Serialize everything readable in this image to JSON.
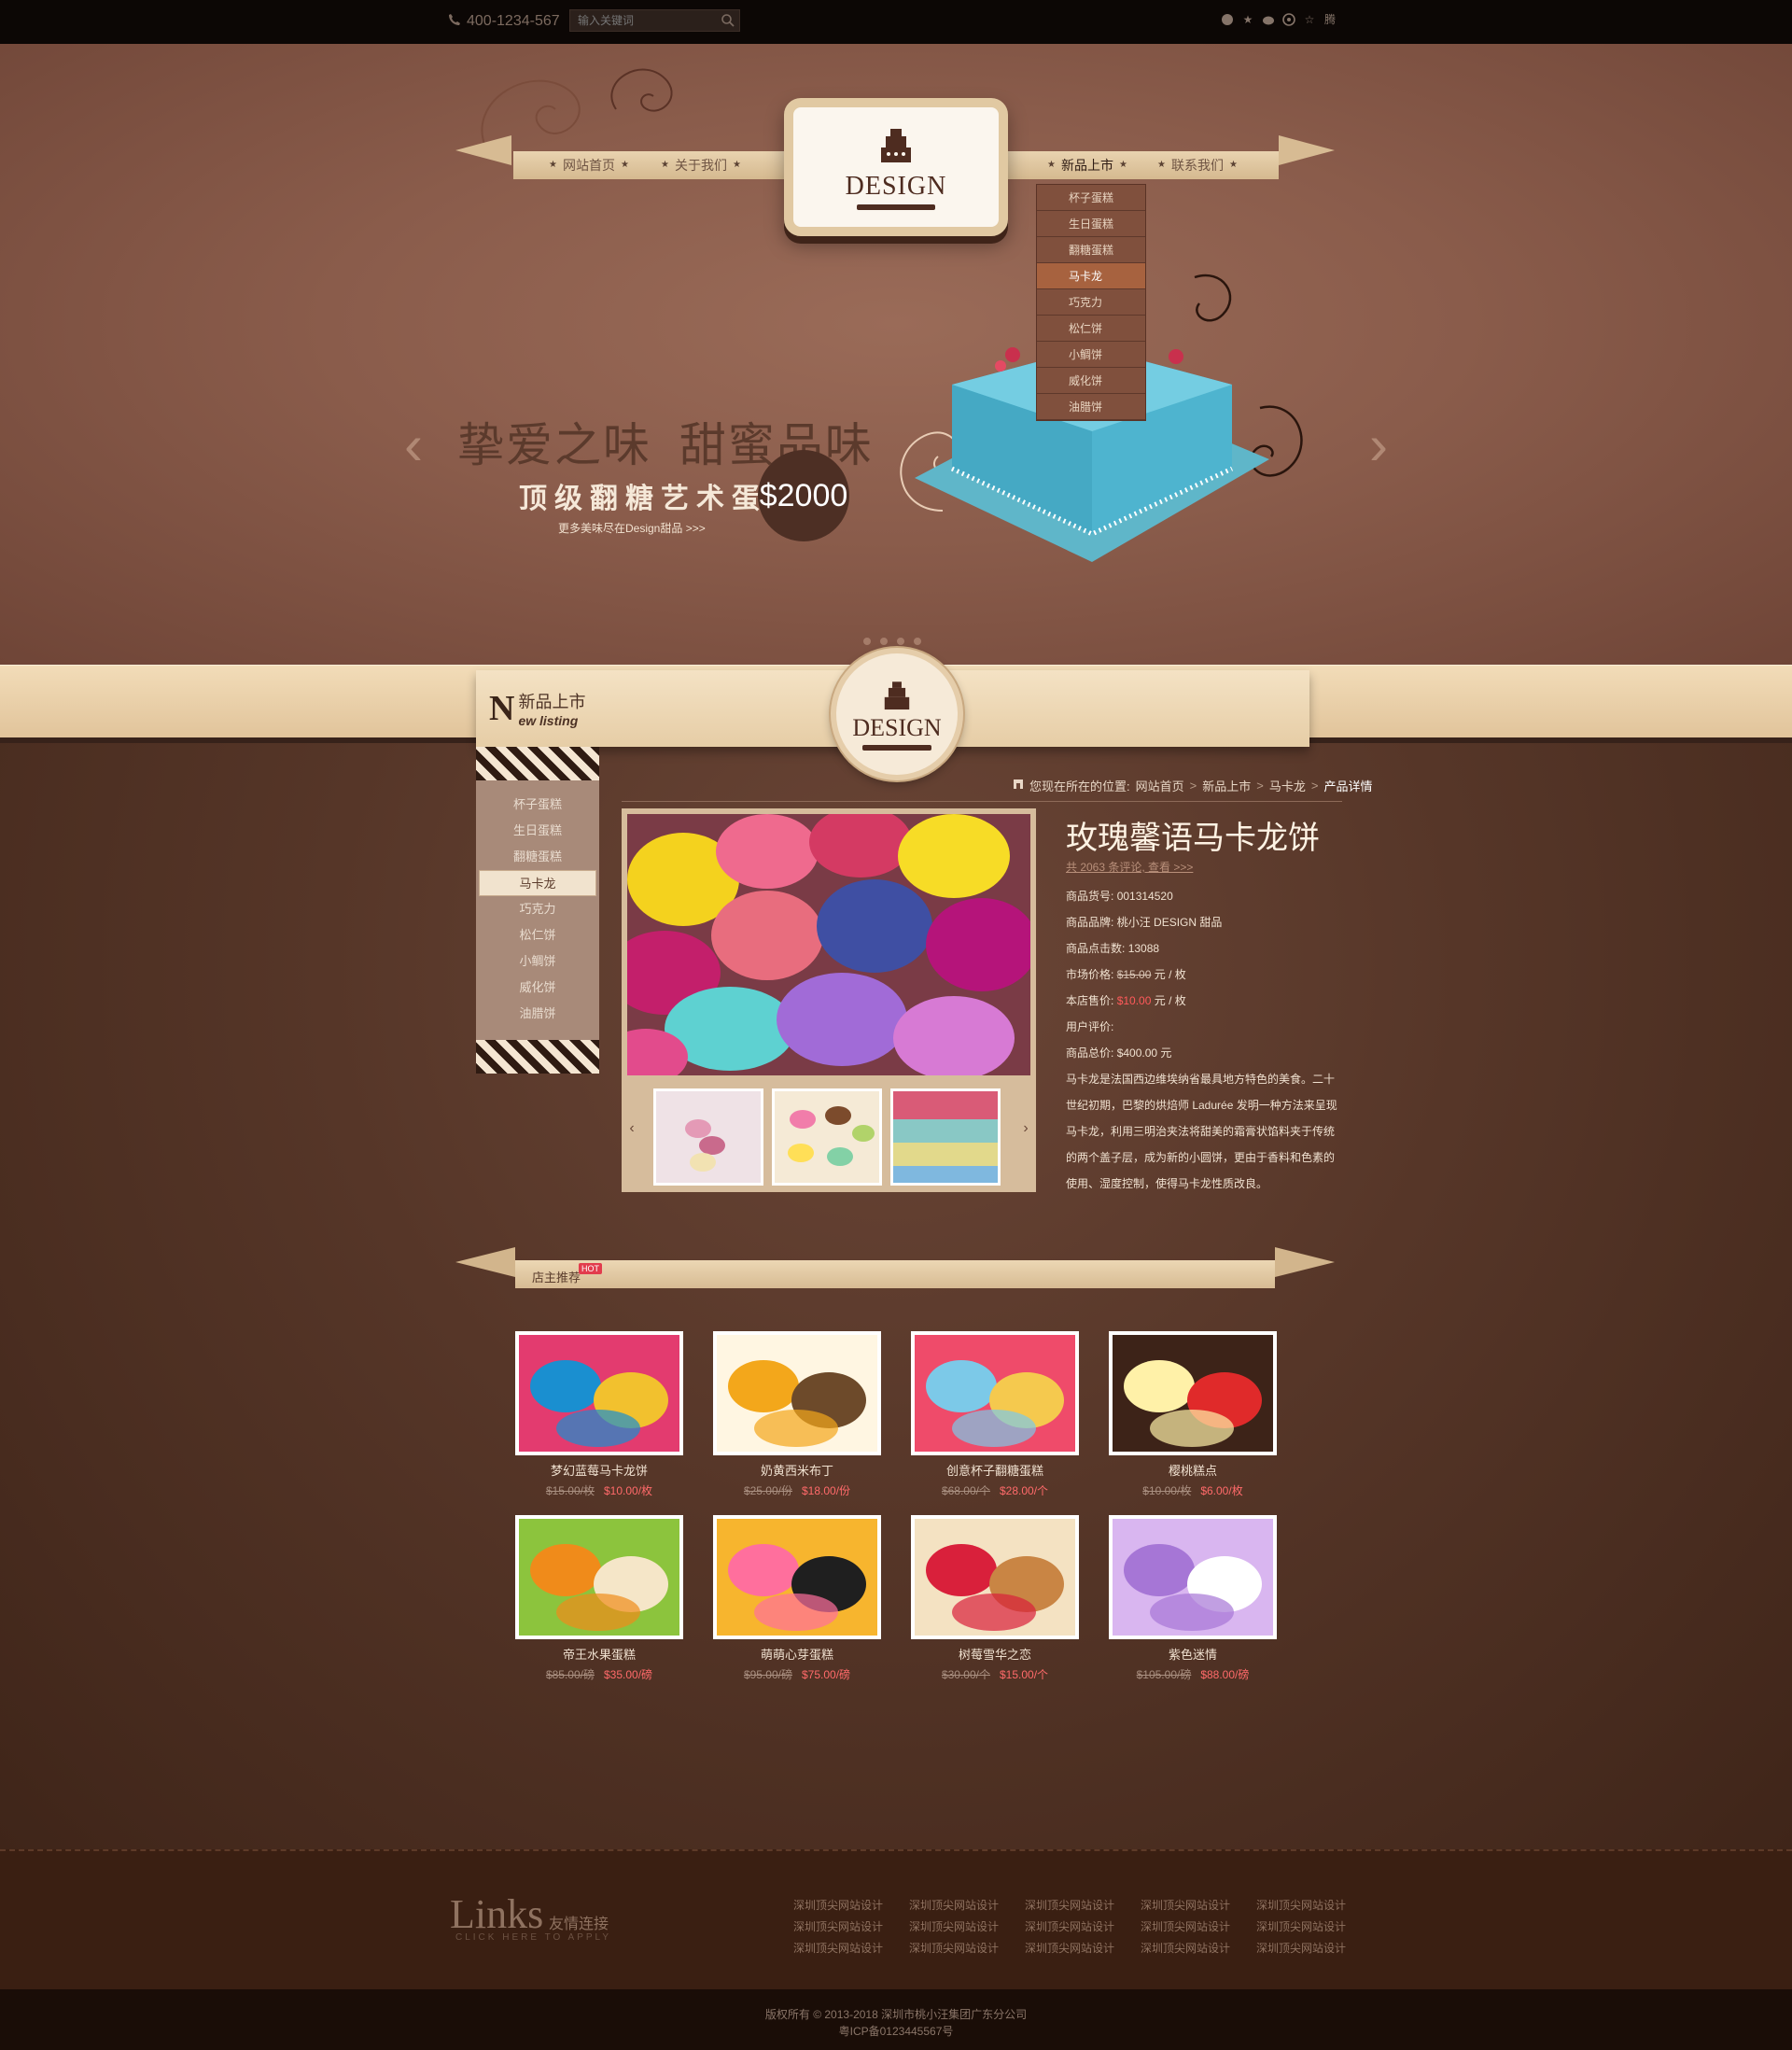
{
  "topbar": {
    "phone": "400-1234-567",
    "search_placeholder": "输入关键词",
    "social_icons": [
      "globe-icon",
      "star-icon",
      "weibo-icon",
      "pinterest-icon",
      "favorite-icon",
      "qq-icon"
    ],
    "social_last_label": "腾"
  },
  "nav": {
    "items": [
      "网站首页",
      "关于我们",
      "新品上市",
      "联系我们"
    ],
    "logo_text": "DESIGN"
  },
  "dropdown": {
    "items": [
      "杯子蛋糕",
      "生日蛋糕",
      "翻糖蛋糕",
      "马卡龙",
      "巧克力",
      "松仁饼",
      "小鲷饼",
      "威化饼",
      "油腊饼"
    ],
    "active_index": 3
  },
  "hero": {
    "title_a": "挚爱之味",
    "title_b": "甜蜜品味",
    "subtitle": "顶级翻糖艺术蛋糕",
    "price": "$2000",
    "more": "更多美味尽在Design甜品 >>>",
    "slide_count": 4,
    "current_slide": 0
  },
  "section": {
    "title_cn": "新品上市",
    "title_en_initial": "N",
    "title_en_rest": "ew listing",
    "badge_text": "DESIGN"
  },
  "sidebar": {
    "items": [
      "杯子蛋糕",
      "生日蛋糕",
      "翻糖蛋糕",
      "马卡龙",
      "巧克力",
      "松仁饼",
      "小鲷饼",
      "威化饼",
      "油腊饼"
    ],
    "active_index": 3
  },
  "breadcrumb": {
    "prefix": "您现在所在的位置:",
    "items": [
      "网站首页",
      "新品上市",
      "马卡龙",
      "产品详情"
    ],
    "separator": ">"
  },
  "product": {
    "title": "玫瑰馨语马卡龙饼",
    "reviews": "共 2063 条评论, 查看 >>>",
    "rows": [
      {
        "label": "商品货号:",
        "value": "001314520"
      },
      {
        "label": "商品品牌:",
        "value": "桃小汪 DESIGN 甜品"
      },
      {
        "label": "商品点击数:",
        "value": "13088"
      },
      {
        "label": "用户评价:",
        "value": ""
      },
      {
        "label": "商品总价:",
        "value": "$400.00 元"
      }
    ],
    "market_price_label": "市场价格:",
    "market_price": "$15.00",
    "market_price_unit": "元 / 枚",
    "store_price_label": "本店售价:",
    "store_price": "$10.00",
    "store_price_unit": "元 / 枚",
    "description": "马卡龙是法国西边维埃纳省最具地方特色的美食。二十世纪初期，巴黎的烘焙师 Ladurée 发明一种方法来呈现马卡龙，利用三明治夹法将甜美的霜膏状馅料夹于传统的两个盖子层，成为新的小圆饼，更由于香料和色素的使用、湿度控制，使得马卡龙性质改良。"
  },
  "recommend": {
    "title": "店主推荐",
    "hot": "HOT",
    "products": [
      {
        "name": "梦幻蓝莓马卡龙饼",
        "old": "$15.00/枚",
        "price": "$10.00/枚",
        "colors": [
          "#1a8fd0",
          "#e33b6f",
          "#f2c12e"
        ]
      },
      {
        "name": "奶黄西米布丁",
        "old": "$25.00/份",
        "price": "$18.00/份",
        "colors": [
          "#f3a71b",
          "#fff6e2",
          "#6d4a2a"
        ]
      },
      {
        "name": "创意杯子翻糖蛋糕",
        "old": "$68.00/个",
        "price": "$28.00/个",
        "colors": [
          "#7cc9e8",
          "#ef4b6a",
          "#f5c94e"
        ]
      },
      {
        "name": "樱桃糕点",
        "old": "$10.00/枚",
        "price": "$6.00/枚",
        "colors": [
          "#fff1a8",
          "#3d2318",
          "#e02a2a"
        ]
      },
      {
        "name": "帝王水果蛋糕",
        "old": "$85.00/磅",
        "price": "$35.00/磅",
        "colors": [
          "#f08b1a",
          "#8cc43d",
          "#f5e6c8"
        ]
      },
      {
        "name": "萌萌心芽蛋糕",
        "old": "$95.00/磅",
        "price": "$75.00/磅",
        "colors": [
          "#ff6f9d",
          "#f7b52e",
          "#1f1f1f"
        ]
      },
      {
        "name": "树莓雪华之恋",
        "old": "$30.00/个",
        "price": "$15.00/个",
        "colors": [
          "#d9203b",
          "#f4e2c2",
          "#c98544"
        ]
      },
      {
        "name": "紫色迷情",
        "old": "$105.00/磅",
        "price": "$88.00/磅",
        "colors": [
          "#a676d6",
          "#d9b6f0",
          "#ffffff"
        ]
      }
    ]
  },
  "footer": {
    "links_title": "Links",
    "links_cn": "友情连接",
    "links_en": "CLICK HERE TO APPLY",
    "links": [
      "深圳顶尖网站设计",
      "深圳顶尖网站设计",
      "深圳顶尖网站设计",
      "深圳顶尖网站设计",
      "深圳顶尖网站设计",
      "深圳顶尖网站设计",
      "深圳顶尖网站设计",
      "深圳顶尖网站设计",
      "深圳顶尖网站设计",
      "深圳顶尖网站设计",
      "深圳顶尖网站设计",
      "深圳顶尖网站设计",
      "深圳顶尖网站设计",
      "深圳顶尖网站设计",
      "深圳顶尖网站设计"
    ],
    "copyright": "版权所有 © 2013-2018 深圳市桃小汪集团广东分公司",
    "icp": "粤ICP备0123445567号"
  }
}
